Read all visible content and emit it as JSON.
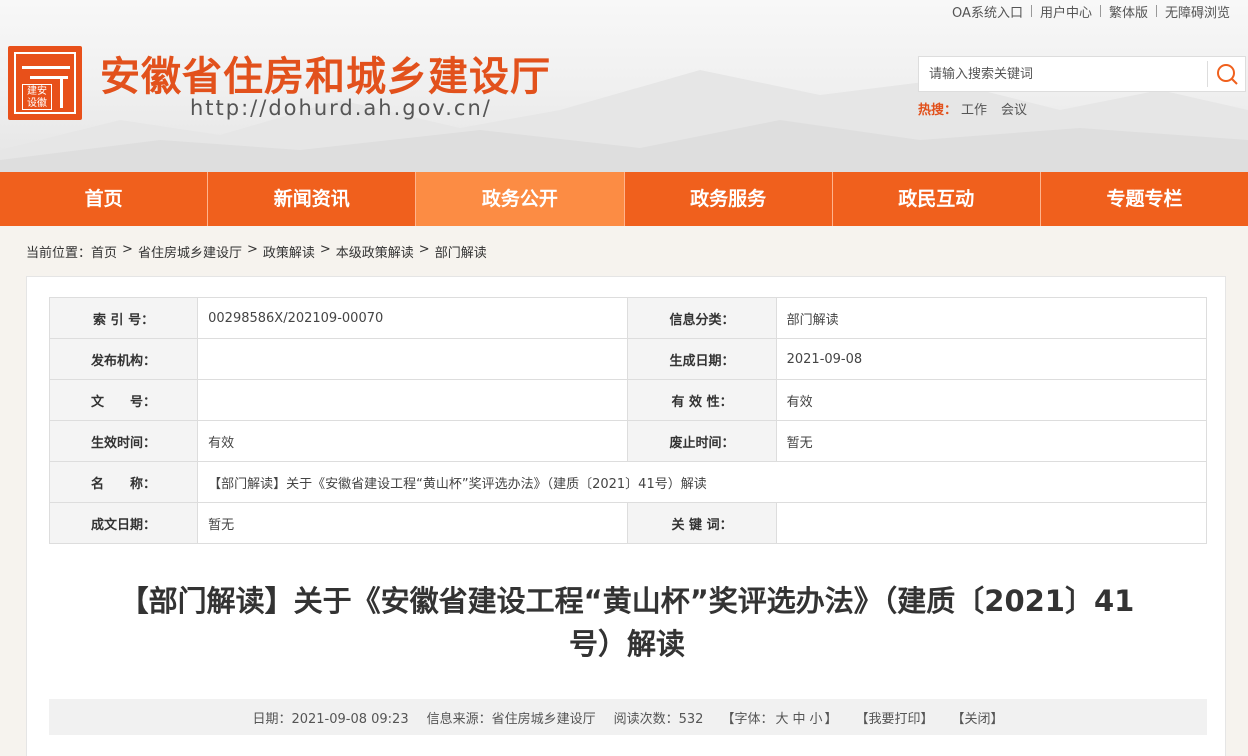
{
  "top_links": [
    "OA系统入口",
    "用户中心",
    "繁体版",
    "无障碍浏览"
  ],
  "logo": {
    "seal_text": "建安设徽"
  },
  "site": {
    "title": "安徽省住房和城乡建设厅",
    "url": "http://dohurd.ah.gov.cn/"
  },
  "search": {
    "placeholder": "请输入搜索关键词"
  },
  "hot_search": {
    "label": "热搜：",
    "items": [
      "工作",
      "会议"
    ]
  },
  "nav": {
    "items": [
      "首页",
      "新闻资讯",
      "政务公开",
      "政务服务",
      "政民互动",
      "专题专栏"
    ],
    "active_index": 2
  },
  "breadcrumb": {
    "prefix": "当前位置：",
    "items": [
      "首页",
      "省住房城乡建设厅",
      "政策解读",
      "本级政策解读",
      "部门解读"
    ],
    "separator": ">"
  },
  "info": {
    "index_label": "索 引 号：",
    "index_value": "00298586X/202109-00070",
    "category_label": "信息分类：",
    "category_value": "部门解读",
    "publisher_label": "发布机构：",
    "publisher_value": "",
    "created_label": "生成日期：",
    "created_value": "2021-09-08",
    "docno_label": "文　　号：",
    "docno_value": "",
    "validity_label": "有 效 性：",
    "validity_value": "有效",
    "effective_label": "生效时间：",
    "effective_value": "有效",
    "abolish_label": "废止时间：",
    "abolish_value": "暂无",
    "name_label": "名　　称：",
    "name_value": "【部门解读】关于《安徽省建设工程“黄山杯”奖评选办法》（建质〔2021〕41号）解读",
    "written_label": "成文日期：",
    "written_value": "暂无",
    "keywords_label": "关 键 词：",
    "keywords_value": ""
  },
  "article": {
    "title_line1": "【部门解读】关于《安徽省建设工程“黄山杯”奖评选办法》（建质〔2021〕41",
    "title_line2": "号）解读"
  },
  "meta": {
    "date": "日期：2021-09-08 09:23",
    "source": "信息来源：省住房城乡建设厅",
    "views": "阅读次数：532",
    "font_prefix": "【字体：",
    "font_large": "大",
    "font_medium": "中",
    "font_small": "小",
    "font_suffix": "】",
    "print": "【我要打印】",
    "close": "【关闭】"
  },
  "colors": {
    "brand": "#f0601d",
    "nav_active": "#fc8c44",
    "title": "#e2511c"
  }
}
